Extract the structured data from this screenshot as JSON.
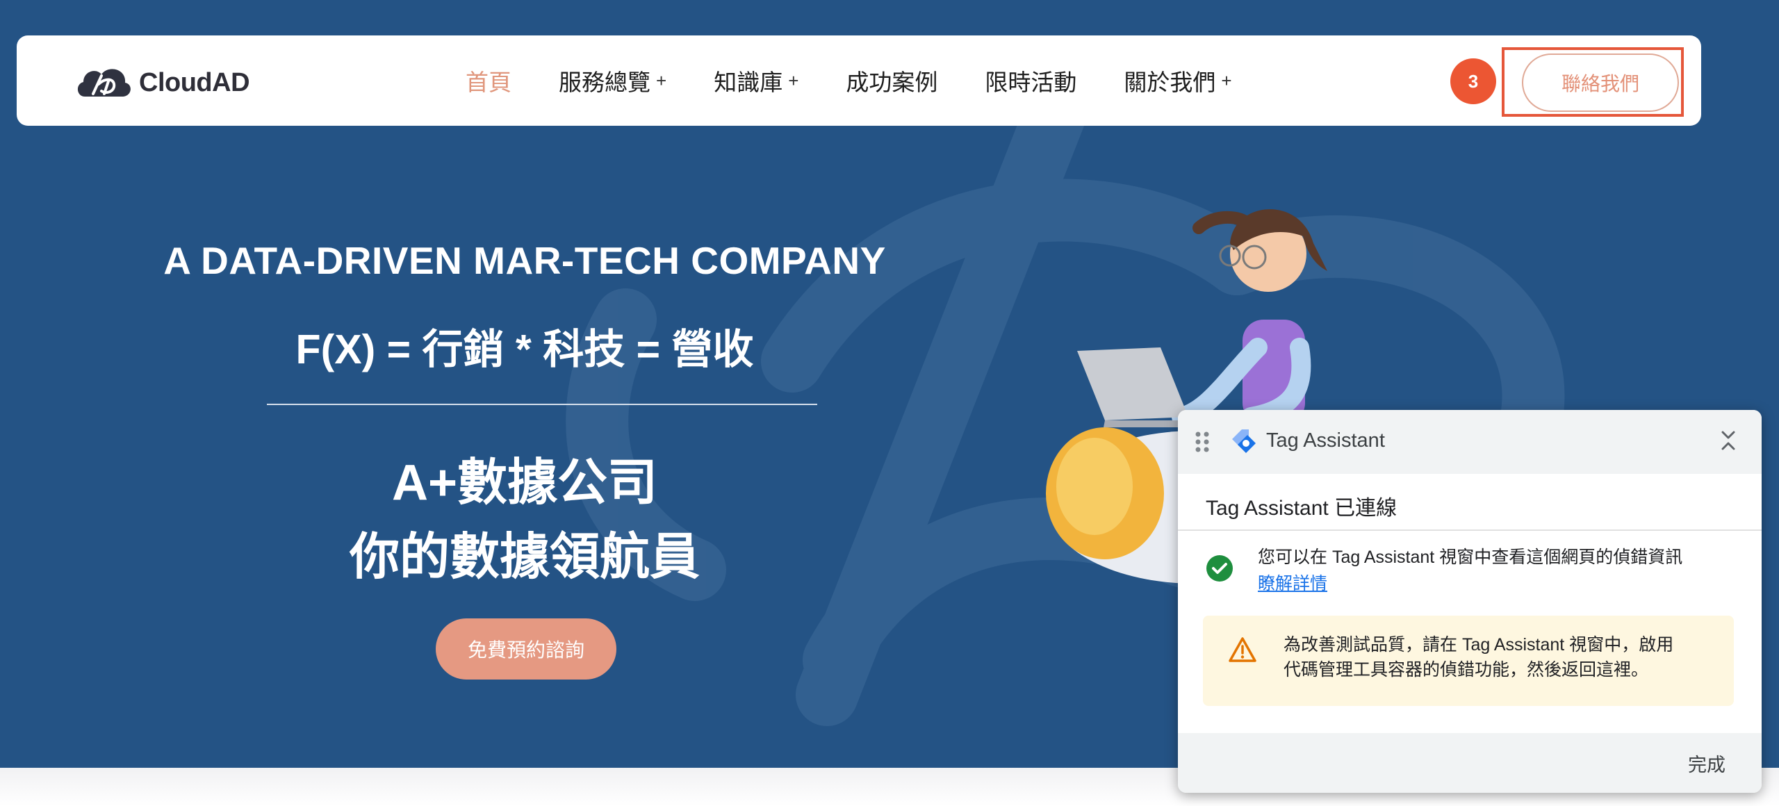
{
  "brand": {
    "name": "CloudAD",
    "logo_icon": "cloud-ad-logo-icon"
  },
  "nav": {
    "items": [
      {
        "label": "首頁",
        "active": true,
        "has_submenu": false
      },
      {
        "label": "服務總覽",
        "active": false,
        "has_submenu": true
      },
      {
        "label": "知識庫",
        "active": false,
        "has_submenu": true
      },
      {
        "label": "成功案例",
        "active": false,
        "has_submenu": false
      },
      {
        "label": "限時活動",
        "active": false,
        "has_submenu": false
      },
      {
        "label": "關於我們",
        "active": false,
        "has_submenu": true
      }
    ],
    "submenu_symbol": "+",
    "badge_count": "3",
    "contact_label": "聯絡我們"
  },
  "hero": {
    "tagline_en": "A DATA-DRIVEN MAR-TECH COMPANY",
    "formula": "F(X) = 行銷 * 科技 = 營收",
    "heading_line1": "A+數據公司",
    "heading_line2": "你的數據領航員",
    "cta_label": "免費預約諮詢"
  },
  "tag_assistant": {
    "title": "Tag Assistant",
    "status": "Tag Assistant 已連線",
    "info_text": "您可以在 Tag Assistant 視窗中查看這個網頁的偵錯資訊",
    "info_link": "瞭解詳情",
    "warning_line1": "為改善測試品質，請在 Tag Assistant 視窗中，啟用",
    "warning_line2": "代碼管理工具容器的偵錯功能，然後返回這裡。",
    "done_label": "完成",
    "icons": [
      "drag-handle-icon",
      "tag-assistant-logo-icon",
      "collapse-icon",
      "check-circle-icon",
      "warning-icon"
    ]
  },
  "colors": {
    "hero_bg": "#245385",
    "accent": "#e0967c",
    "badge": "#ec5633",
    "highlight_outline": "#e5573a",
    "cta_bg": "#e59982",
    "link": "#1a73e8",
    "success": "#1e8e3e",
    "warning": "#e37400",
    "warning_bg": "#fef7e0"
  }
}
